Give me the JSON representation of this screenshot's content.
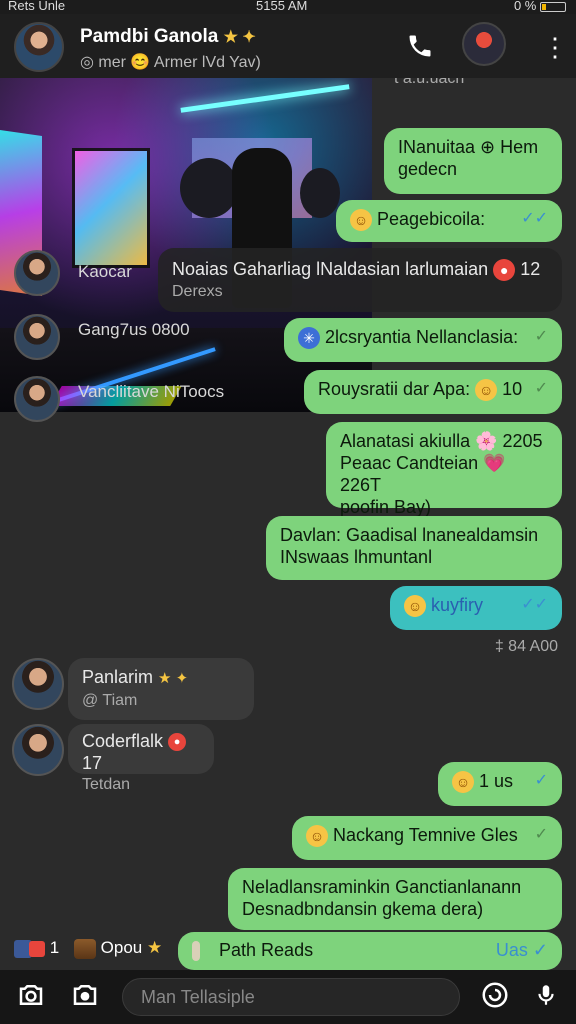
{
  "status_bar": {
    "carrier": "Rets Unle",
    "time": "5155 AM",
    "battery": "0 %"
  },
  "header": {
    "contact_name": "Pamdbi Ganola",
    "badges": "★ ✦",
    "subtitle": "◎ mer 😊 Armer lVd Yav)"
  },
  "chat": {
    "date_fragment": "t   a.u.uacn",
    "overlay_messages": [
      {
        "name": "Kaocar",
        "text": "Noaias Gaharliag lNaldasian larlumaian",
        "emoji": "🎯",
        "count": "12",
        "subtext": "Derexs"
      },
      {
        "name": "Gang7us 0800"
      },
      {
        "name": "Vancliitave NiToocs"
      }
    ],
    "messages": [
      {
        "text": "INanuitaa ⊕ Hem gedecn"
      },
      {
        "emoji": "😀",
        "text": "Peagebicoila:",
        "ticks": "✓✓"
      },
      {
        "emoji": "✳",
        "text": "2lcsryantia Nellanclasia:",
        "ticks": "✓"
      },
      {
        "text": "Rouysratii dar Apa:",
        "emoji": "😀",
        "count": "10",
        "ticks": "✓"
      },
      {
        "line1": "Alanatasi akiulla 🌸 2205",
        "line2": "Peaac Candteian 💗 226T",
        "line3": "poofin Bay)"
      },
      {
        "line1": "Davlan: Gaadisal lnanealdamsin",
        "line2": "INswaas lhmuntanl"
      },
      {
        "emoji": "😀",
        "text": "kuyfiry",
        "ticks": "✓✓"
      },
      {
        "line1": "Neladlansraminkin Ganctianlanann",
        "line2": "Desnadbndansin gkema dera)"
      },
      {
        "emoji": "😀",
        "count": "1 us",
        "ticks": "✓"
      },
      {
        "emoji": "😀",
        "text": "Nackang Temnive Gles",
        "ticks": "✓"
      },
      {
        "text": "Path Reads",
        "meta": "Uas",
        "ticks": "✓"
      }
    ],
    "timestamp": "‡ 84 A00",
    "incoming": [
      {
        "name": "Panlarim",
        "badges": "★ ✦",
        "sub": "@ Tiam"
      },
      {
        "name": "Coderflalk",
        "emoji": "🎯",
        "count": "17",
        "sub": "Tetdan"
      }
    ],
    "reactions": {
      "count": "1",
      "label": "Opou",
      "badge": "★"
    }
  },
  "composer": {
    "placeholder": "Man Tellasiple"
  }
}
